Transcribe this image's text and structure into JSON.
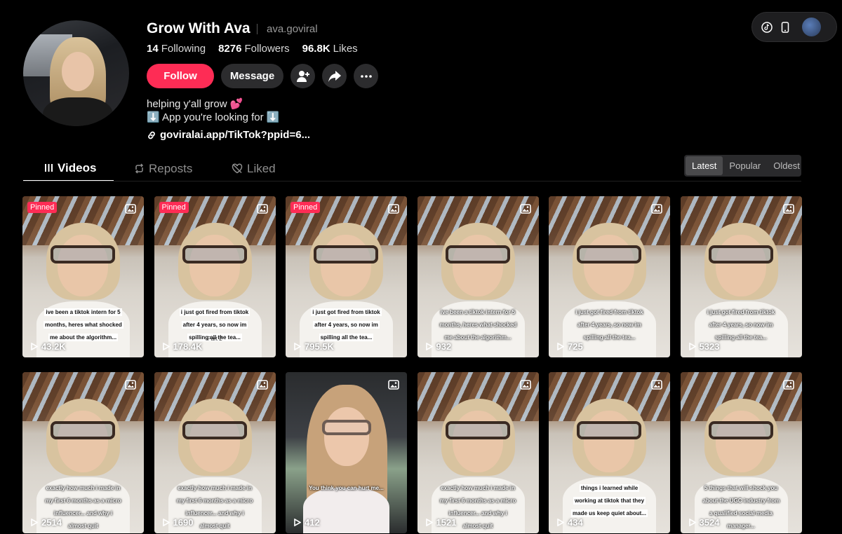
{
  "profile": {
    "display_name": "Grow With Ava",
    "username": "ava.goviral",
    "following_count": "14",
    "following_label": "Following",
    "followers_count": "8276",
    "followers_label": "Followers",
    "likes_count": "96.8K",
    "likes_label": "Likes",
    "bio_line1": "helping y'all grow 💕",
    "bio_line2": "⬇️ App you're looking for ⬇️",
    "link": "goviralai.app/TikTok?ppid=6..."
  },
  "actions": {
    "follow_label": "Follow",
    "message_label": "Message",
    "icons": [
      "add-friend-icon",
      "share-icon",
      "more-icon"
    ]
  },
  "top_bar": {
    "icons": [
      "tiktok-logo-icon",
      "mobile-device-icon",
      "user-avatar"
    ]
  },
  "tabs": [
    {
      "label": "Videos",
      "icon": "grid-icon",
      "active": true
    },
    {
      "label": "Reposts",
      "icon": "repost-icon",
      "active": false
    },
    {
      "label": "Liked",
      "icon": "heart-hidden-icon",
      "active": false
    }
  ],
  "sort": [
    {
      "label": "Latest",
      "active": true
    },
    {
      "label": "Popular",
      "active": false
    },
    {
      "label": "Oldest",
      "active": false
    }
  ],
  "pinned_label": "Pinned",
  "videos": [
    {
      "pinned": true,
      "caption": "ive been a tiktok intern for 5 months, heres what shocked me about the algorithm...",
      "style": "boxed",
      "views": "43.2K"
    },
    {
      "pinned": true,
      "caption": "i just got fired from tiktok after 4 years, so now im spilling all the tea...",
      "style": "boxed",
      "sub": "Part 2",
      "views": "178.4K"
    },
    {
      "pinned": true,
      "caption": "i just got fired from tiktok after 4 years, so now im spilling all the tea...",
      "style": "boxed",
      "views": "795.5K"
    },
    {
      "pinned": false,
      "caption": "ive been a tiktok intern for 5 months, heres what shocked me about the algorithm...",
      "style": "shadowed",
      "views": "932"
    },
    {
      "pinned": false,
      "caption": "i just got fired from tiktok after 4 years, so now im spilling all the tea...",
      "style": "shadowed",
      "views": "725"
    },
    {
      "pinned": false,
      "caption": "i just got fired from tiktok after 4 years, so now im spilling all the tea...",
      "style": "shadowed",
      "views": "5323"
    },
    {
      "pinned": false,
      "caption": "exactly how much i made in my first 6 months as a micro influencer... and why i almost quit",
      "style": "shadowed",
      "views": "2514"
    },
    {
      "pinned": false,
      "caption": "exactly how much i made in my first 6 months as a micro influencer... and why i almost quit",
      "style": "shadowed",
      "views": "1690"
    },
    {
      "pinned": false,
      "caption": "You think you can hurt me...",
      "style": "shadowed",
      "views": "412",
      "alt": true
    },
    {
      "pinned": false,
      "caption": "exactly how much i made in my first 6 months as a micro influencer... and why i almost quit",
      "style": "shadowed",
      "views": "1521"
    },
    {
      "pinned": false,
      "caption": "things i learned while working at tiktok that they made us keep quiet about...",
      "style": "boxed",
      "views": "434"
    },
    {
      "pinned": false,
      "caption": "5 things that will shock you about the UGC industry from a qualified social media manager...",
      "style": "shadowed",
      "views": "3524"
    }
  ]
}
